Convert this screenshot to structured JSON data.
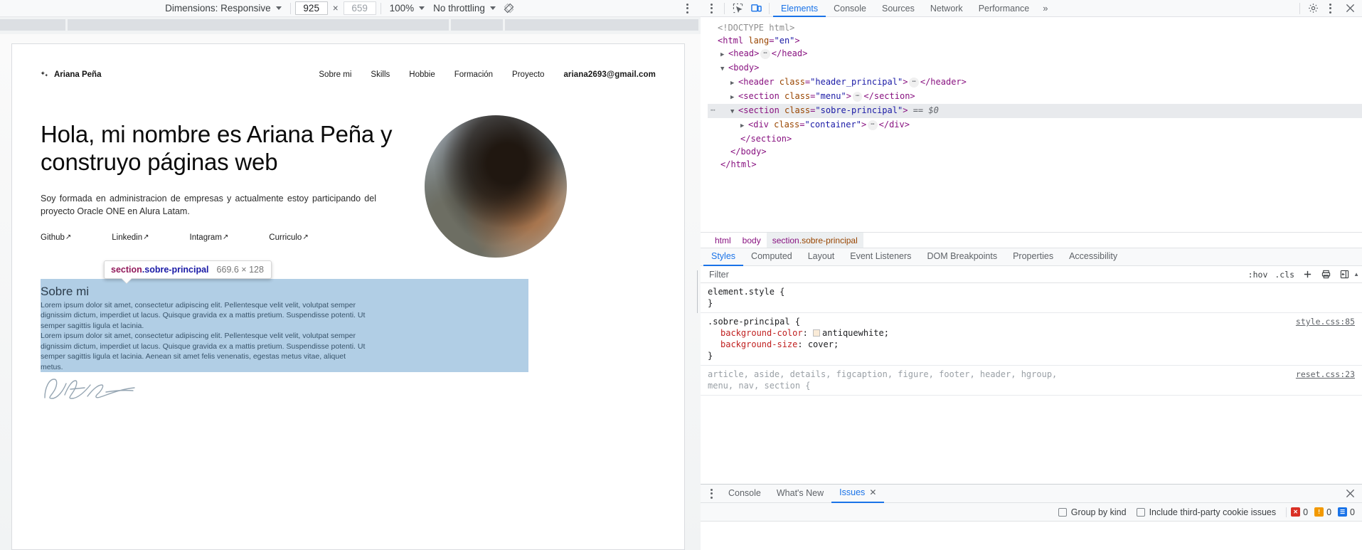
{
  "device_toolbar": {
    "dimensions_label": "Dimensions: Responsive",
    "width_value": "925",
    "multiply": "×",
    "height_value": "659",
    "zoom_label": "100%",
    "throttling_label": "No throttling",
    "rotate_icon": "rotate-icon",
    "more_options_icon": "kebab-menu-icon"
  },
  "page": {
    "brand": "Ariana Peña",
    "nav": [
      {
        "label": "Sobre mi"
      },
      {
        "label": "Skills"
      },
      {
        "label": "Hobbie"
      },
      {
        "label": "Formación"
      },
      {
        "label": "Proyecto"
      },
      {
        "label": "ariana2693@gmail.com"
      }
    ],
    "hero": {
      "title": "Hola, mi nombre es Ariana Peña y construyo páginas web",
      "paragraph": "Soy formada en administracion de empresas y actualmente estoy participando del proyecto Oracle ONE en Alura Latam.",
      "links": [
        {
          "label": "Github",
          "arrow": "↗"
        },
        {
          "label": "Linkedin",
          "arrow": "↗"
        },
        {
          "label": "Intagram",
          "arrow": "↗"
        },
        {
          "label": "Curriculo",
          "arrow": "↗"
        }
      ]
    },
    "about": {
      "title": "Sobre mi",
      "paragraph_1": "Lorem ipsum dolor sit amet, consectetur adipiscing elit. Pellentesque velit velit, volutpat semper dignissim dictum, imperdiet ut lacus. Quisque gravida ex a mattis pretium. Suspendisse potenti. Ut semper sagittis ligula et lacinia.",
      "paragraph_2": "Lorem ipsum dolor sit amet, consectetur adipiscing elit. Pellentesque velit velit, volutpat semper dignissim dictum, imperdiet ut lacus. Quisque gravida ex a mattis pretium. Suspendisse potenti. Ut semper sagittis ligula et lacinia. Aenean sit amet felis venenatis, egestas metus vitae, aliquet metus."
    }
  },
  "inspect_tooltip": {
    "tag": "section",
    "class": ".sobre-principal",
    "dimensions": "669.6 × 128"
  },
  "devtools": {
    "inspect_icon": "inspect-element-icon",
    "device_toggle_icon": "device-toolbar-icon",
    "tabs": [
      {
        "label": "Elements",
        "active": true
      },
      {
        "label": "Console",
        "active": false
      },
      {
        "label": "Sources",
        "active": false
      },
      {
        "label": "Network",
        "active": false
      },
      {
        "label": "Performance",
        "active": false
      }
    ],
    "more_tabs_icon": "chevron-double-right-icon",
    "settings_icon": "gear-icon",
    "kebab_icon": "kebab-menu-icon",
    "close_icon": "close-icon",
    "dom": {
      "doctype": "<!DOCTYPE html>",
      "html_open": "<html lang=\"en\">",
      "head": "<head>",
      "head_close": "</head>",
      "body": "<body>",
      "header_tag": "<header class=\"header_principal\">",
      "header_close": "</header>",
      "section_menu": "<section class=\"menu\">",
      "section_menu_close": "</section>",
      "section_sobre": "<section class=\"sobre-principal\">",
      "selected_marker": "== $0",
      "div_container": "<div class=\"container\">",
      "div_container_close": "</div>",
      "section_close": "</section>",
      "body_close": "</body>",
      "html_close": "</html>",
      "ellipsis": "…"
    },
    "breadcrumbs": [
      {
        "label": "html",
        "active": false
      },
      {
        "label": "body",
        "active": false
      },
      {
        "label": "section.sobre-principal",
        "active": true
      }
    ],
    "styles_tabs": [
      {
        "label": "Styles",
        "active": true
      },
      {
        "label": "Computed",
        "active": false
      },
      {
        "label": "Layout",
        "active": false
      },
      {
        "label": "Event Listeners",
        "active": false
      },
      {
        "label": "DOM Breakpoints",
        "active": false
      },
      {
        "label": "Properties",
        "active": false
      },
      {
        "label": "Accessibility",
        "active": false
      }
    ],
    "filter": {
      "placeholder": "Filter",
      "value": "",
      "hov_label": ":hov",
      "cls_label": ".cls",
      "new_rule_icon": "plus-icon",
      "print_icon": "print-media-icon",
      "sidebar_icon": "toggle-sidebar-icon"
    },
    "rules": [
      {
        "selector": "element.style {",
        "close": "}",
        "source": "",
        "declarations": [],
        "inherited": false
      },
      {
        "selector": ".sobre-principal {",
        "close": "}",
        "source": "style.css:85",
        "declarations": [
          {
            "property": "background-color",
            "value": "antiquewhite",
            "swatch": "#faebd7"
          },
          {
            "property": "background-size",
            "value": "cover",
            "swatch": ""
          }
        ],
        "inherited": false
      },
      {
        "selector": "article, aside, details, figcaption, figure, footer, header, hgroup,",
        "selector_line2": "menu, nav, section {",
        "close": "",
        "source": "reset.css:23",
        "declarations": [],
        "inherited": true
      }
    ],
    "drawer": {
      "kebab_icon": "kebab-menu-icon",
      "tabs": [
        {
          "label": "Console",
          "active": false,
          "closable": false
        },
        {
          "label": "What's New",
          "active": false,
          "closable": false
        },
        {
          "label": "Issues",
          "active": true,
          "closable": true
        }
      ],
      "close_icon": "close-icon",
      "group_by_kind_label": "Group by kind",
      "group_by_kind_checked": false,
      "third_party_label": "Include third-party cookie issues",
      "third_party_checked": false,
      "counters": [
        {
          "kind": "errors",
          "count": "0",
          "color": "#d93025"
        },
        {
          "kind": "warnings",
          "count": "0",
          "color": "#f29900"
        },
        {
          "kind": "info",
          "count": "0",
          "color": "#1a73e8"
        }
      ]
    }
  }
}
